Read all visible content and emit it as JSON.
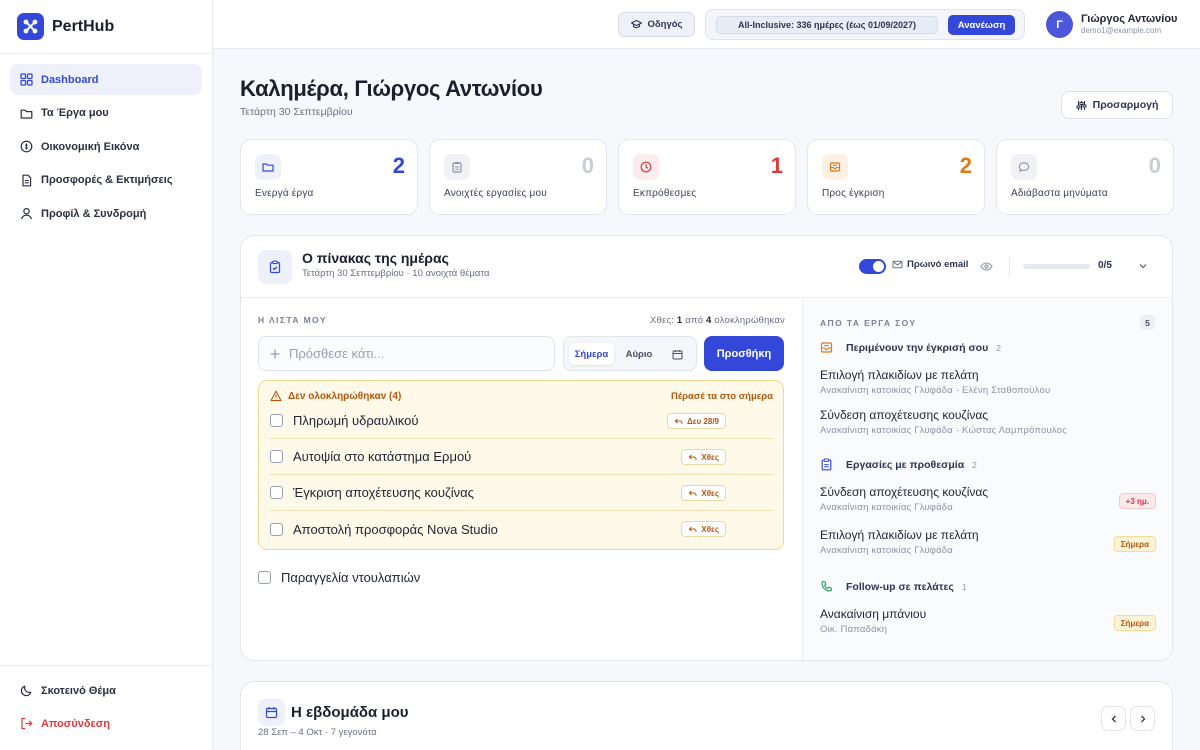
{
  "app": {
    "name": "PertHub"
  },
  "sidebar": {
    "items": [
      {
        "label": "Dashboard",
        "icon": "grid-icon",
        "active": true
      },
      {
        "label": "Τα Έργα μου",
        "icon": "folder-icon"
      },
      {
        "label": "Οικονομική Εικόνα",
        "icon": "coin-icon"
      },
      {
        "label": "Προσφορές & Εκτιμήσεις",
        "icon": "document-icon"
      },
      {
        "label": "Προφίλ & Συνδρομή",
        "icon": "user-icon"
      }
    ],
    "bottom": {
      "theme_label": "Σκοτεινό Θέμα",
      "logout_label": "Αποσύνδεση"
    }
  },
  "topbar": {
    "guide_label": "Οδηγός",
    "plan_text": "All-Inclusive: 336 ημέρες (έως 01/09/2027)",
    "renew_label": "Ανανέωση",
    "user": {
      "initial": "Γ",
      "name": "Γιώργος Αντωνίου",
      "email": "demo1@example.com"
    }
  },
  "header": {
    "greeting": "Καλημέρα, Γιώργος Αντωνίου",
    "date": "Τετάρτη 30 Σεπτεμβρίου",
    "customize_label": "Προσαρμογή"
  },
  "stats": [
    {
      "label": "Ενεργά έργα",
      "value": "2",
      "color": "#3348d8",
      "icon": "folder-icon"
    },
    {
      "label": "Ανοιχτές εργασίες μου",
      "value": "0",
      "color": "#c9ccd6",
      "icon": "clipboard-icon"
    },
    {
      "label": "Εκπρόθεσμες",
      "value": "1",
      "color": "#e03a3a",
      "icon": "clock-icon"
    },
    {
      "label": "Προς έγκριση",
      "value": "2",
      "color": "#e07a16",
      "icon": "inbox-icon"
    },
    {
      "label": "Αδιάβαστα μηνύματα",
      "value": "0",
      "color": "#c9ccd6",
      "icon": "chat-icon"
    }
  ],
  "board": {
    "title": "Ο πίνακας της ημέρας",
    "subtitle": "Τετάρτη 30 Σεπτεμβρίου · 10 ανοιχτά θέματα",
    "email_label": "Πρωινό email",
    "email_enabled": true,
    "progress_text": "0/5",
    "progress_fraction": 0,
    "my_list": {
      "label": "Η ΛΙΣΤΑ ΜΟΥ",
      "yesterday_prefix": "Χθες:",
      "yesterday_done": "1",
      "yesterday_of": "από",
      "yesterday_total": "4",
      "yesterday_suffix": "ολοκληρώθηκαν",
      "input_placeholder": "Πρόσθεσε κάτι...",
      "seg_today": "Σήμερα",
      "seg_tomorrow": "Αύριο",
      "add_label": "Προσθήκη",
      "overdue_title": "Δεν ολοκληρώθηκαν (4)",
      "move_label": "Πέρασέ τα στο σήμερα",
      "overdue": [
        {
          "text": "Πληρωμή υδραυλικού",
          "due": "Δευ 28/9"
        },
        {
          "text": "Αυτοψία στο κατάστημα Ερμού",
          "due": "Χθες"
        },
        {
          "text": "Έγκριση αποχέτευσης κουζίνας",
          "due": "Χθες"
        },
        {
          "text": "Αποστολή προσφοράς Nova Studio",
          "due": "Χθες"
        }
      ],
      "extra": "Παραγγελία ντουλαπιών"
    },
    "from_projects": {
      "label": "ΑΠΟ ΤΑ ΕΡΓΑ ΣΟΥ",
      "count": "5",
      "sections": [
        {
          "title": "Περιμένουν την έγκρισή σου",
          "count": "2",
          "icon": "inbox-icon",
          "items": [
            {
              "title": "Επιλογή πλακιδίων με πελάτη",
              "sub": "Ανακαίνιση κατοικίας Γλυφάδα · Ελένη Σταθοπούλου"
            },
            {
              "title": "Σύνδεση αποχέτευσης κουζίνας",
              "sub": "Ανακαίνιση κατοικίας Γλυφάδα · Κώστας Λαμπρόπουλος"
            }
          ]
        },
        {
          "title": "Εργασίες με προθεσμία",
          "count": "2",
          "icon": "clipboard-icon",
          "items": [
            {
              "title": "Σύνδεση αποχέτευσης κουζίνας",
              "sub": "Ανακαίνιση κατοικίας Γλυφάδα",
              "tag": "+3 ημ."
            },
            {
              "title": "Επιλογή πλακιδίων με πελάτη",
              "sub": "Ανακαίνιση κατοικίας Γλυφάδα",
              "tag": "Σήμερα"
            }
          ]
        },
        {
          "title": "Follow-up σε πελάτες",
          "count": "1",
          "icon": "phone-icon",
          "items": [
            {
              "title": "Ανακαίνιση μπάνιου",
              "sub": "Οικ. Παπαδάκη",
              "tag": "Σήμερα"
            }
          ]
        }
      ]
    }
  },
  "week": {
    "title": "Η εβδομάδα μου",
    "subtitle": "28 Σεπ – 4 Οκτ · 7 γεγονότα"
  }
}
